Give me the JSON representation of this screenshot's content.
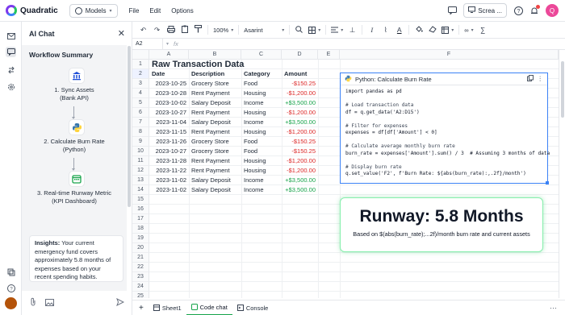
{
  "app": {
    "name": "Quadratic"
  },
  "header": {
    "models_label": "Models",
    "menu": [
      "File",
      "Edit",
      "Options"
    ],
    "share_label": "Screa ...",
    "avatar_initial": "Q"
  },
  "chat": {
    "title": "AI Chat",
    "workflow_title": "Workflow Summary",
    "steps": [
      {
        "line1": "1. Sync Assets",
        "line2": "(Bank API)",
        "icon": "bank-icon"
      },
      {
        "line1": "2. Calculate Burn Rate",
        "line2": "(Python)",
        "icon": "python-icon"
      },
      {
        "line1": "3. Real-time Runway Metric",
        "line2": "(KPI Dashboard)",
        "icon": "calendar-icon"
      }
    ],
    "insights_label": "Insights:",
    "insights_text": " Your current emergency fund covers approximately 5.8 months of expenses based on your recent spending habits."
  },
  "toolbar": {
    "zoom": "100%",
    "font": "Asarint"
  },
  "formula_bar": {
    "cell_ref": "A2",
    "fx": "fx"
  },
  "grid": {
    "columns": [
      "A",
      "B",
      "C",
      "D",
      "E",
      "F"
    ],
    "title": "Raw Transaction Data",
    "headers": [
      "Date",
      "Description",
      "Category",
      "Amount"
    ],
    "rows": [
      [
        "2023-10-25",
        "Grocery Store",
        "Food",
        "-$150.25"
      ],
      [
        "2023-10-28",
        "Rent Payment",
        "Housing",
        "-$1,200.00"
      ],
      [
        "2023-10-02",
        "Salary Deposit",
        "Income",
        "+$3,500.00"
      ],
      [
        "2023-10-27",
        "Rent Payment",
        "Housing",
        "-$1,200.00"
      ],
      [
        "2023-11-04",
        "Salary Deposit",
        "Income",
        "+$3,500.00"
      ],
      [
        "2023-11-15",
        "Rent Payment",
        "Housing",
        "-$1,200.00"
      ],
      [
        "2023-11-26",
        "Grocery Store",
        "Food",
        "-$150.25"
      ],
      [
        "2023-10-27",
        "Grocery Store",
        "Food",
        "-$150.25"
      ],
      [
        "2023-11-28",
        "Rent Payment",
        "Housing",
        "-$1,200.00"
      ],
      [
        "2023-11-22",
        "Rent Payment",
        "Housing",
        "-$1,200.00"
      ],
      [
        "2023-11-02",
        "Salary Deposit",
        "Income",
        "+$3,500.00"
      ],
      [
        "2023-11-02",
        "Salary Deposit",
        "Income",
        "+$3,500.00"
      ]
    ],
    "row_numbers": [
      "1",
      "2",
      "3",
      "4",
      "5",
      "6",
      "7",
      "8",
      "9",
      "10",
      "11",
      "12",
      "13",
      "14",
      "15",
      "16",
      "17",
      "18",
      "19",
      "20",
      "21",
      "22",
      "23",
      "24",
      "25"
    ]
  },
  "code_cell": {
    "title": "Python: Calculate Burn Rate",
    "lines": [
      "import pandas as pd",
      "",
      "# Load transaction data",
      "df = q.get_data('A2:D15')",
      "",
      "# Filter for expenses",
      "expenses = df[df['Amount'] < 0]",
      "",
      "# Calculate average monthly burn rate",
      "burn_rate = expenses['Amount'].sum() / 3  # Assuming 3 months of data",
      "",
      "# Display burn rate",
      "q.set_value('F2', f'Burn Rate: ${abs(burn_rate):,.2f}/month')"
    ]
  },
  "runway_card": {
    "title": "Runway: 5.8 Months",
    "subtitle": "Based on $(abs(burn_rate);...2f)/month burn rate and current assets"
  },
  "sheet_bar": {
    "tabs": [
      "Sheet1",
      "Code chat",
      "Console"
    ]
  },
  "colors": {
    "accent": "#16a34a",
    "negative": "#dc2626",
    "selection": "#3b82f6"
  }
}
